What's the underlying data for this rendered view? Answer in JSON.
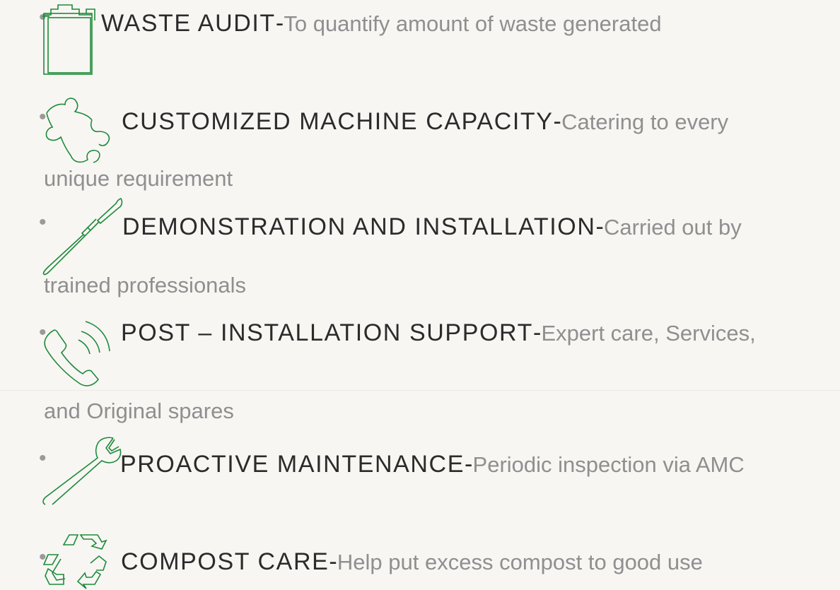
{
  "items": [
    {
      "title": "WASTE AUDIT",
      "dash": "-",
      "desc": "To quantify amount of waste generated",
      "cont": "",
      "icon": "clipboard-icon"
    },
    {
      "title": "CUSTOMIZED MACHINE CAPACITY",
      "dash": "-",
      "desc": "Catering to every",
      "cont": "unique requirement",
      "icon": "puzzle-piece-icon"
    },
    {
      "title": "DEMONSTRATION AND INSTALLATION",
      "dash": "-",
      "desc": "Carried out by",
      "cont": "trained professionals",
      "icon": "screwdriver-icon"
    },
    {
      "title": "POST – INSTALLATION SUPPORT",
      "dash": "-",
      "desc": "Expert care, Services,",
      "cont": "and Original spares",
      "icon": "phone-icon"
    },
    {
      "title": "PROACTIVE MAINTENANCE",
      "dash": "-",
      "desc": "Periodic inspection via AMC",
      "cont": "",
      "icon": "wrench-icon"
    },
    {
      "title": "COMPOST CARE",
      "dash": "-",
      "desc": "Help put excess compost to good use",
      "cont": "",
      "icon": "recycle-icon"
    }
  ],
  "bullet_char": "•",
  "colors": {
    "background": "#f7f6f3",
    "icon_green": "#1e8a3a",
    "title_text": "#2b2b2b",
    "desc_text": "#8f8f8f",
    "bullet": "#9a9a9a"
  }
}
